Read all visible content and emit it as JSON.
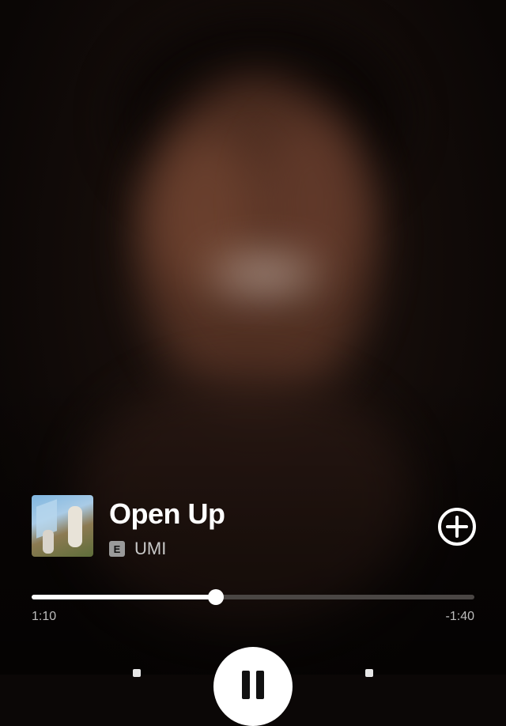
{
  "now_playing": {
    "title": "Open Up",
    "explicit_badge": "E",
    "artist": "UMI",
    "add_icon": "plus-circle-icon"
  },
  "progress": {
    "elapsed": "1:10",
    "remaining": "-1:40",
    "fraction": 0.416
  },
  "controls": {
    "play_pause_icon": "pause-icon"
  },
  "colors": {
    "text_primary": "#ffffff",
    "text_secondary": "#bdbdbd",
    "track_bg": "#4a4644",
    "track_fill": "#ffffff"
  }
}
